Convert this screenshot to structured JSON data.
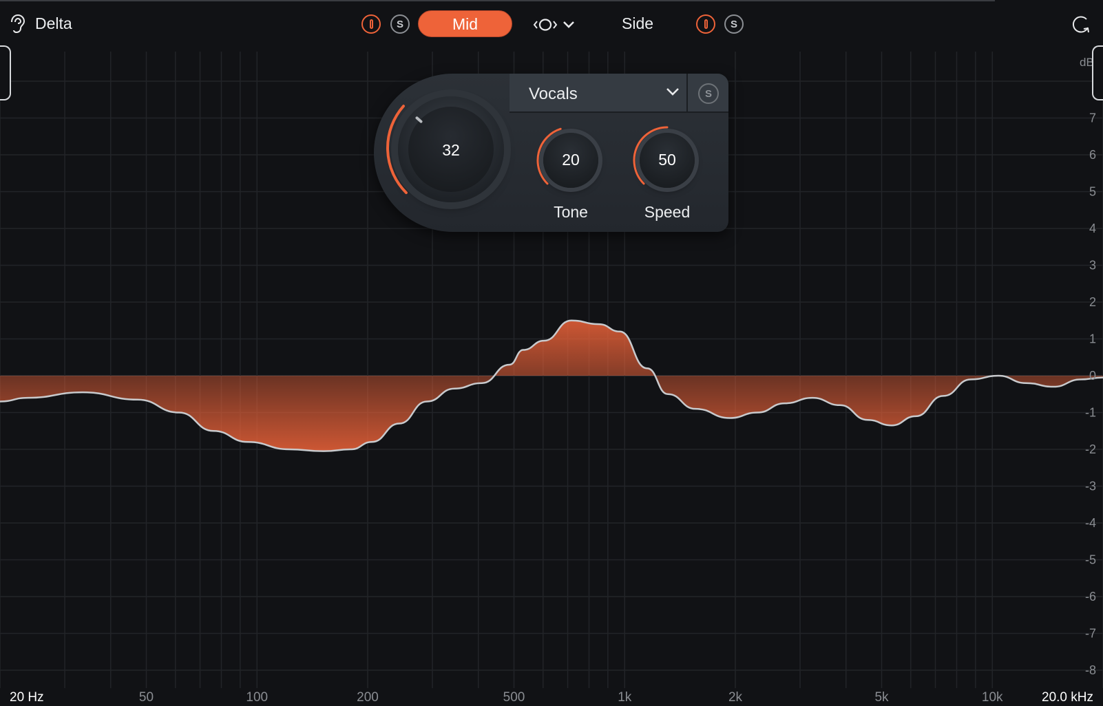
{
  "header": {
    "delta_label": "Delta",
    "mid_label": "Mid",
    "side_label": "Side",
    "solo_glyph": "S"
  },
  "module": {
    "preset": "Vocals",
    "solo_glyph": "S",
    "amount": {
      "value": "32",
      "level": 0.32
    },
    "tone": {
      "label": "Tone",
      "value": "20",
      "level": 0.2
    },
    "speed": {
      "label": "Speed",
      "value": "50",
      "level": 0.5
    }
  },
  "graph": {
    "db_unit": "dB",
    "db_ticks": [
      "7",
      "6",
      "5",
      "4",
      "3",
      "2",
      "1",
      "0",
      "-1",
      "-2",
      "-3",
      "-4",
      "-5",
      "-6",
      "-7",
      "-8"
    ],
    "freq_ticks": [
      "20 Hz",
      "50",
      "100",
      "200",
      "500",
      "1k",
      "2k",
      "5k",
      "10k",
      "20.0 kHz"
    ]
  },
  "colors": {
    "accent": "#ee6339",
    "background": "#111215",
    "curve": "#c8cacd",
    "grid": "#26282c"
  },
  "icons": {
    "delta": "ear-icon",
    "link": "stereo-link-icon",
    "reset": "refresh-icon"
  }
}
